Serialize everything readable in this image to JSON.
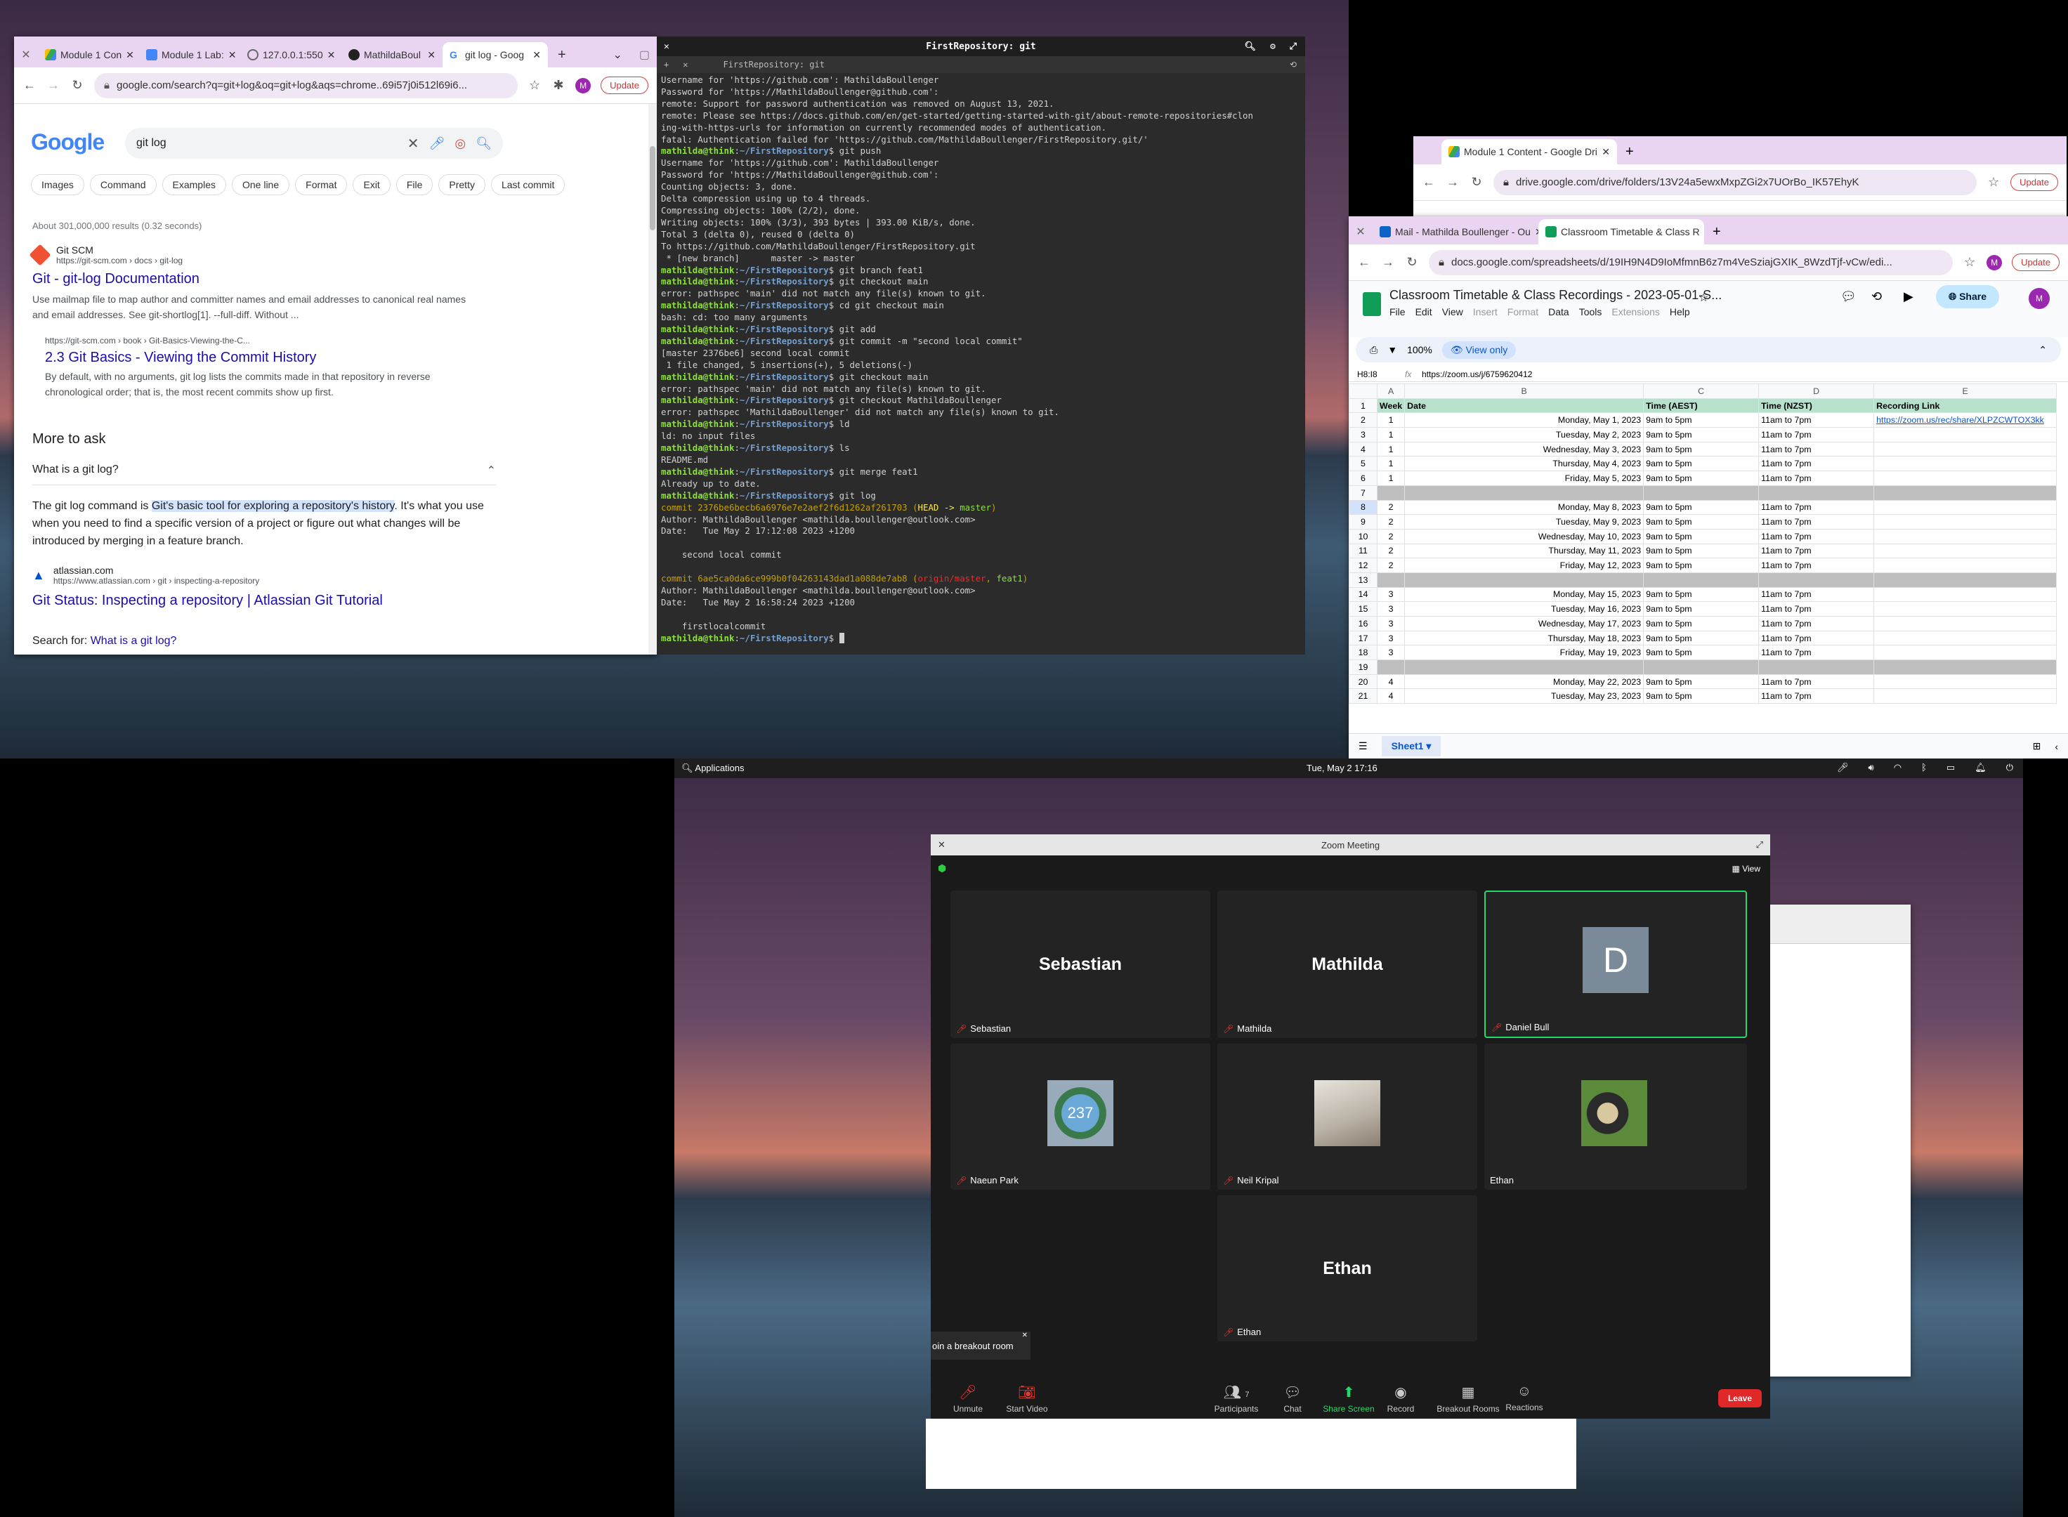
{
  "google_window": {
    "tabs": [
      "Module 1 Con",
      "Module 1 Lab:",
      "127.0.0.1:550",
      "MathildaBoul",
      "git log - Goog"
    ],
    "url": "google.com/search?q=git+log&oq=git+log&aqs=chrome..69i57j0i512l69i6...",
    "update": "Update",
    "avatar": "M",
    "logo": "Google",
    "query": "git log",
    "filters": [
      "Images",
      "Command",
      "Examples",
      "One line",
      "Format",
      "Exit",
      "File",
      "Pretty",
      "Last commit"
    ],
    "stats": "About 301,000,000 results (0.32 seconds)",
    "r1": {
      "site": "Git SCM",
      "url": "https://git-scm.com › docs › git-log",
      "title": "Git - git-log Documentation",
      "snippet": "Use mailmap file to map author and committer names and email addresses to canonical real names and email addresses. See git-shortlog[1]. --full-diff. Without ..."
    },
    "r1b": {
      "url": "https://git-scm.com › book › Git-Basics-Viewing-the-C...",
      "title": "2.3 Git Basics - Viewing the Commit History",
      "snippet": "By default, with no arguments, git log lists the commits made in that repository in reverse chronological order; that is, the most recent commits show up first."
    },
    "more": "More to ask",
    "q1": "What is a git log?",
    "ans_pre": "The git log command is ",
    "ans_hl": "Git's basic tool for exploring a repository's history",
    "ans_post": ". It's what you use when you need to find a specific version of a project or figure out what changes will be introduced by merging in a feature branch.",
    "r2": {
      "site": "atlassian.com",
      "url": "https://www.atlassian.com › git › inspecting-a-repository",
      "title": "Git Status: Inspecting a repository | Atlassian Git Tutorial"
    },
    "searchfor": "Search for: ",
    "searchlink": "What is a git log?"
  },
  "terminal": {
    "title": "FirstRepository: git",
    "tab": "FirstRepository: git"
  },
  "drive_window": {
    "tab": "Module 1 Content - Google Dri",
    "url": "drive.google.com/drive/folders/13V24a5ewxMxpZGi2x7UOrBo_IK57EhyK",
    "update": "Update"
  },
  "sheets_window": {
    "tabs": [
      "Mail - Mathilda Boullenger - Ou",
      "Classroom Timetable & Class R"
    ],
    "url": "docs.google.com/spreadsheets/d/19IH9N4D9IoMfmnB6z7m4VeSziajGXIK_8WzdTjf-vCw/edi...",
    "update": "Update",
    "doc_title": "Classroom Timetable & Class Recordings - 2023-05-01-S...",
    "menus": [
      "File",
      "Edit",
      "View",
      "Insert",
      "Format",
      "Data",
      "Tools",
      "Extensions",
      "Help"
    ],
    "share": "Share",
    "zoom": "100%",
    "viewonly": "View only",
    "cellref": "H8:I8",
    "formula": "https://zoom.us/j/6759620412",
    "cols": [
      "A",
      "B",
      "C",
      "D",
      "E"
    ],
    "headers": [
      "Week",
      "Date",
      "Time (AEST)",
      "Time (NZST)",
      "Recording Link"
    ],
    "sheet": "Sheet1"
  },
  "topbar": {
    "apps": "Applications",
    "clock": "Tue, May 2   17:16"
  },
  "zoom": {
    "title": "Zoom Meeting",
    "view": "View",
    "tiles": [
      {
        "big": "Sebastian",
        "name": "Sebastian"
      },
      {
        "big": "Mathilda",
        "name": "Mathilda"
      },
      {
        "letter": "D",
        "name": "Daniel Bull"
      },
      {
        "avatar": "237",
        "name": "Naeun Park"
      },
      {
        "name": "Neil Kripal"
      },
      {
        "name": "Ethan"
      },
      {
        "big": "Ethan",
        "name": "Ethan"
      }
    ],
    "breakout": "oin a breakout room",
    "buttons": [
      "Unmute",
      "Start Video",
      "Participants",
      "Chat",
      "Share Screen",
      "Record",
      "Breakout Rooms",
      "Reactions"
    ],
    "participants_count": "7",
    "leave": "Leave"
  }
}
